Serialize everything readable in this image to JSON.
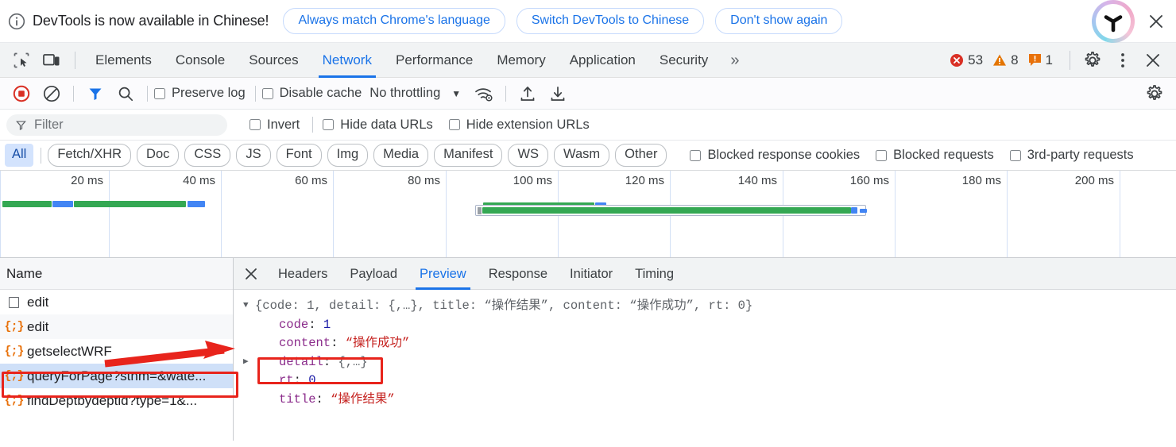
{
  "banner": {
    "info_icon": "info-circle-icon",
    "message": "DevTools is now available in Chinese!",
    "buttons": [
      {
        "label": "Always match Chrome's language",
        "name": "always-match-language-button"
      },
      {
        "label": "Switch DevTools to Chinese",
        "name": "switch-devtools-chinese-button"
      },
      {
        "label": "Don't show again",
        "name": "dont-show-again-button"
      }
    ],
    "avatar_icon": "profile-avatar-logo",
    "close_icon": "close-icon"
  },
  "tabbar": {
    "inspect_icon": "inspect-element-icon",
    "device_icon": "device-toolbar-icon",
    "tabs": [
      {
        "label": "Elements",
        "active": false
      },
      {
        "label": "Console",
        "active": false
      },
      {
        "label": "Sources",
        "active": false
      },
      {
        "label": "Network",
        "active": true
      },
      {
        "label": "Performance",
        "active": false
      },
      {
        "label": "Memory",
        "active": false
      },
      {
        "label": "Application",
        "active": false
      },
      {
        "label": "Security",
        "active": false
      }
    ],
    "more_tabs_label": "»",
    "counters": {
      "errors": "53",
      "warnings": "8",
      "issues": "1",
      "error_color": "#d93025",
      "warning_color": "#e37400",
      "issue_color": "#e8710a"
    },
    "settings_icon": "gear-icon",
    "more_icon": "kebab-menu-icon",
    "close_icon": "close-icon"
  },
  "nettoolbar": {
    "record_icon": "record-stop-icon",
    "clear_icon": "clear-network-log-icon",
    "filter_icon": "filter-funnel-icon",
    "search_icon": "search-icon",
    "preserve_log_label": "Preserve log",
    "disable_cache_label": "Disable cache",
    "throttling_value": "No throttling",
    "throttle_caret": "▼",
    "network_conditions_icon": "wifi-settings-icon",
    "import_icon": "import-har-icon",
    "export_icon": "export-har-icon",
    "settings_icon": "gear-icon"
  },
  "filterrow": {
    "filter_icon": "filter-funnel-icon",
    "filter_placeholder": "Filter",
    "filter_value": "",
    "invert_label": "Invert",
    "hide_data_urls_label": "Hide data URLs",
    "hide_extension_urls_label": "Hide extension URLs"
  },
  "chiprow": {
    "chips": [
      {
        "label": "All",
        "selected": true
      },
      {
        "label": "Fetch/XHR",
        "selected": false
      },
      {
        "label": "Doc",
        "selected": false
      },
      {
        "label": "CSS",
        "selected": false
      },
      {
        "label": "JS",
        "selected": false
      },
      {
        "label": "Font",
        "selected": false
      },
      {
        "label": "Img",
        "selected": false
      },
      {
        "label": "Media",
        "selected": false
      },
      {
        "label": "Manifest",
        "selected": false
      },
      {
        "label": "WS",
        "selected": false
      },
      {
        "label": "Wasm",
        "selected": false
      },
      {
        "label": "Other",
        "selected": false
      }
    ],
    "blocked_response_cookies_label": "Blocked response cookies",
    "blocked_requests_label": "Blocked requests",
    "third_party_requests_label": "3rd-party requests"
  },
  "overview": {
    "ticks": [
      "20 ms",
      "40 ms",
      "60 ms",
      "80 ms",
      "100 ms",
      "120 ms",
      "140 ms",
      "160 ms",
      "180 ms",
      "200 ms"
    ],
    "bar_green_color": "#34a853",
    "bar_blue_color": "#4285f4"
  },
  "requests": {
    "column_header": "Name",
    "rows": [
      {
        "name": "edit",
        "icon": "document-icon",
        "selected": false
      },
      {
        "name": "edit",
        "icon": "json-icon",
        "selected": false
      },
      {
        "name": "getselectWRF",
        "icon": "json-icon",
        "selected": false
      },
      {
        "name": "queryForPage?stnm=&wate...",
        "icon": "json-icon",
        "selected": true
      },
      {
        "name": "findDeptbydeptid?type=1&...",
        "icon": "json-icon",
        "selected": false
      }
    ]
  },
  "detail": {
    "close_icon": "close-icon",
    "tabs": [
      {
        "label": "Headers",
        "active": false
      },
      {
        "label": "Payload",
        "active": false
      },
      {
        "label": "Preview",
        "active": true
      },
      {
        "label": "Response",
        "active": false
      },
      {
        "label": "Initiator",
        "active": false
      },
      {
        "label": "Timing",
        "active": false
      }
    ],
    "preview": {
      "root_triangle": "▼",
      "root_line": "{code: 1, detail: {,…}, title: “操作结果”, content: “操作成功”, rt: 0}",
      "rows": [
        {
          "triangle": "",
          "key": "code",
          "value": "1",
          "type": "num"
        },
        {
          "triangle": "",
          "key": "content",
          "value": "“操作成功”",
          "type": "str"
        },
        {
          "triangle": "▶",
          "key": "detail",
          "value": "{,…}",
          "type": "obj"
        },
        {
          "triangle": "",
          "key": "rt",
          "value": "0",
          "type": "num"
        },
        {
          "triangle": "",
          "key": "title",
          "value": "“操作结果”",
          "type": "str"
        }
      ]
    }
  },
  "annotations": {
    "arrow_color": "#e8241c",
    "box_color": "#e8241c",
    "arrow_name": "red-pointer-arrow",
    "selected_row_box_name": "highlight-box-selected-request",
    "detail_box_name": "highlight-box-detail-node"
  }
}
